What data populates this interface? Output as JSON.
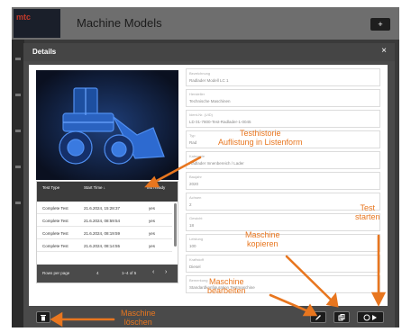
{
  "app": {
    "logo": "mtc",
    "title": "Machine Models",
    "action_icon": "plus-icon"
  },
  "modal": {
    "title": "Details",
    "close_label": "×"
  },
  "history_table": {
    "columns": [
      "Test Type",
      "Start Time ↓",
      "Mit Ready"
    ],
    "rows": [
      [
        "Complete Test",
        "21.6.2024, 15:28:37",
        "yes"
      ],
      [
        "Complete Test",
        "21.6.2024, 08:59:54",
        "yes"
      ],
      [
        "Complete Test",
        "21.6.2024, 08:19:59",
        "yes"
      ],
      [
        "Complete Test",
        "21.6.2024, 08:14:55",
        "yes"
      ]
    ],
    "footer": {
      "rows_per_page_label": "Rows per page",
      "rows_per_page_value": "4",
      "range": "1–4 of 5",
      "prev": "‹",
      "next": "›"
    }
  },
  "fields": [
    {
      "label": "Bezeichnung",
      "value": "Radlader Modell LC 1"
    },
    {
      "label": "Hersteller",
      "value": "Technische Maschinen"
    },
    {
      "label": "Ident-Nr. (UID)",
      "value": "LD 01-7800-Test-Radlader-1-0045"
    },
    {
      "label": "Typ",
      "value": "Rad"
    },
    {
      "label": "Kategorie",
      "value": "Radlader Innenbereich / Lader"
    },
    {
      "label": "Baujahr",
      "value": "2020"
    },
    {
      "label": "Achsen",
      "value": "2"
    },
    {
      "label": "Gewicht",
      "value": "18"
    },
    {
      "label": "Leistung",
      "value": "100"
    },
    {
      "label": "Kraftstoff",
      "value": "Diesel"
    },
    {
      "label": "Bemerkung",
      "value": "Standardkonfiguration Testmaschine"
    }
  ],
  "footer_buttons": {
    "delete_icon": "trash-icon",
    "edit_icon": "pencil-icon",
    "copy_icon": "copy-icon",
    "start_icon": "play-icon"
  },
  "annotations": {
    "history": "Testhistorie\nAuflistung in Listenform",
    "start": "Test\nstarten",
    "copy": "Maschine\nkopieren",
    "edit": "Maschine\nbearbeiten",
    "delete": "Maschine\nlöschen"
  },
  "colors": {
    "accent": "#e8761f",
    "modal_bg": "#4a4a4a",
    "table_header": "#3b3b3b"
  }
}
